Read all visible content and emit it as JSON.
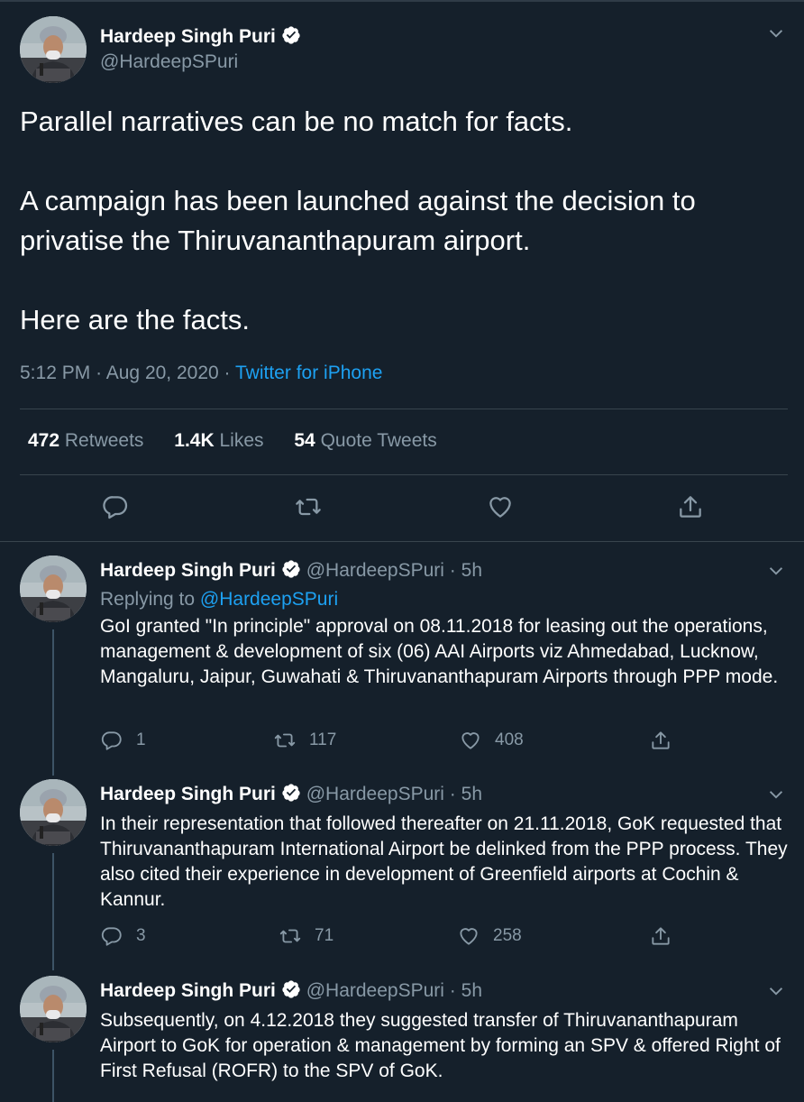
{
  "main_tweet": {
    "author_name": "Hardeep Singh Puri",
    "author_handle": "@HardeepSPuri",
    "text_lines": [
      "Parallel narratives can be no match for facts.",
      "A campaign has been launched against the decision to privatise the Thiruvananthapuram airport.",
      "Here are the facts."
    ],
    "time": "5:12 PM",
    "date": "Aug 20, 2020",
    "separator": "·",
    "source": "Twitter for iPhone",
    "stats": {
      "retweets_count": "472",
      "retweets_label": "Retweets",
      "likes_count": "1.4K",
      "likes_label": "Likes",
      "quotes_count": "54",
      "quotes_label": "Quote Tweets"
    },
    "icons": [
      "reply-icon",
      "retweet-icon",
      "like-icon",
      "share-icon"
    ]
  },
  "replies": [
    {
      "author_name": "Hardeep Singh Puri",
      "author_handle": "@HardeepSPuri",
      "dot": "·",
      "time": "5h",
      "replying_label": "Replying to",
      "replying_to": "@HardeepSPuri",
      "text": "GoI granted \"In principle\" approval on 08.11.2018 for leasing out the operations, management & development of six (06) AAI Airports viz Ahmedabad, Lucknow, Mangaluru, Jaipur, Guwahati & Thiruvananthapuram Airports through PPP mode.",
      "reply_count": "1",
      "retweet_count": "117",
      "like_count": "408"
    },
    {
      "author_name": "Hardeep Singh Puri",
      "author_handle": "@HardeepSPuri",
      "dot": "·",
      "time": "5h",
      "text": "In their representation that followed thereafter on 21.11.2018, GoK requested that Thiruvananthapuram International Airport be delinked from the PPP process. They also cited their experience in development of Greenfield airports at Cochin & Kannur.",
      "reply_count": "3",
      "retweet_count": "71",
      "like_count": "258"
    },
    {
      "author_name": "Hardeep Singh Puri",
      "author_handle": "@HardeepSPuri",
      "dot": "·",
      "time": "5h",
      "text": "Subsequently, on 4.12.2018 they suggested transfer of Thiruvananthapuram Airport to GoK for operation & management by forming an SPV & offered Right of First Refusal (ROFR) to the SPV of GoK."
    }
  ],
  "colors": {
    "background": "#15202b",
    "divider": "#38444d",
    "muted_text": "#8899a6",
    "link": "#1da1f2",
    "verified_badge": "#ffffff"
  }
}
